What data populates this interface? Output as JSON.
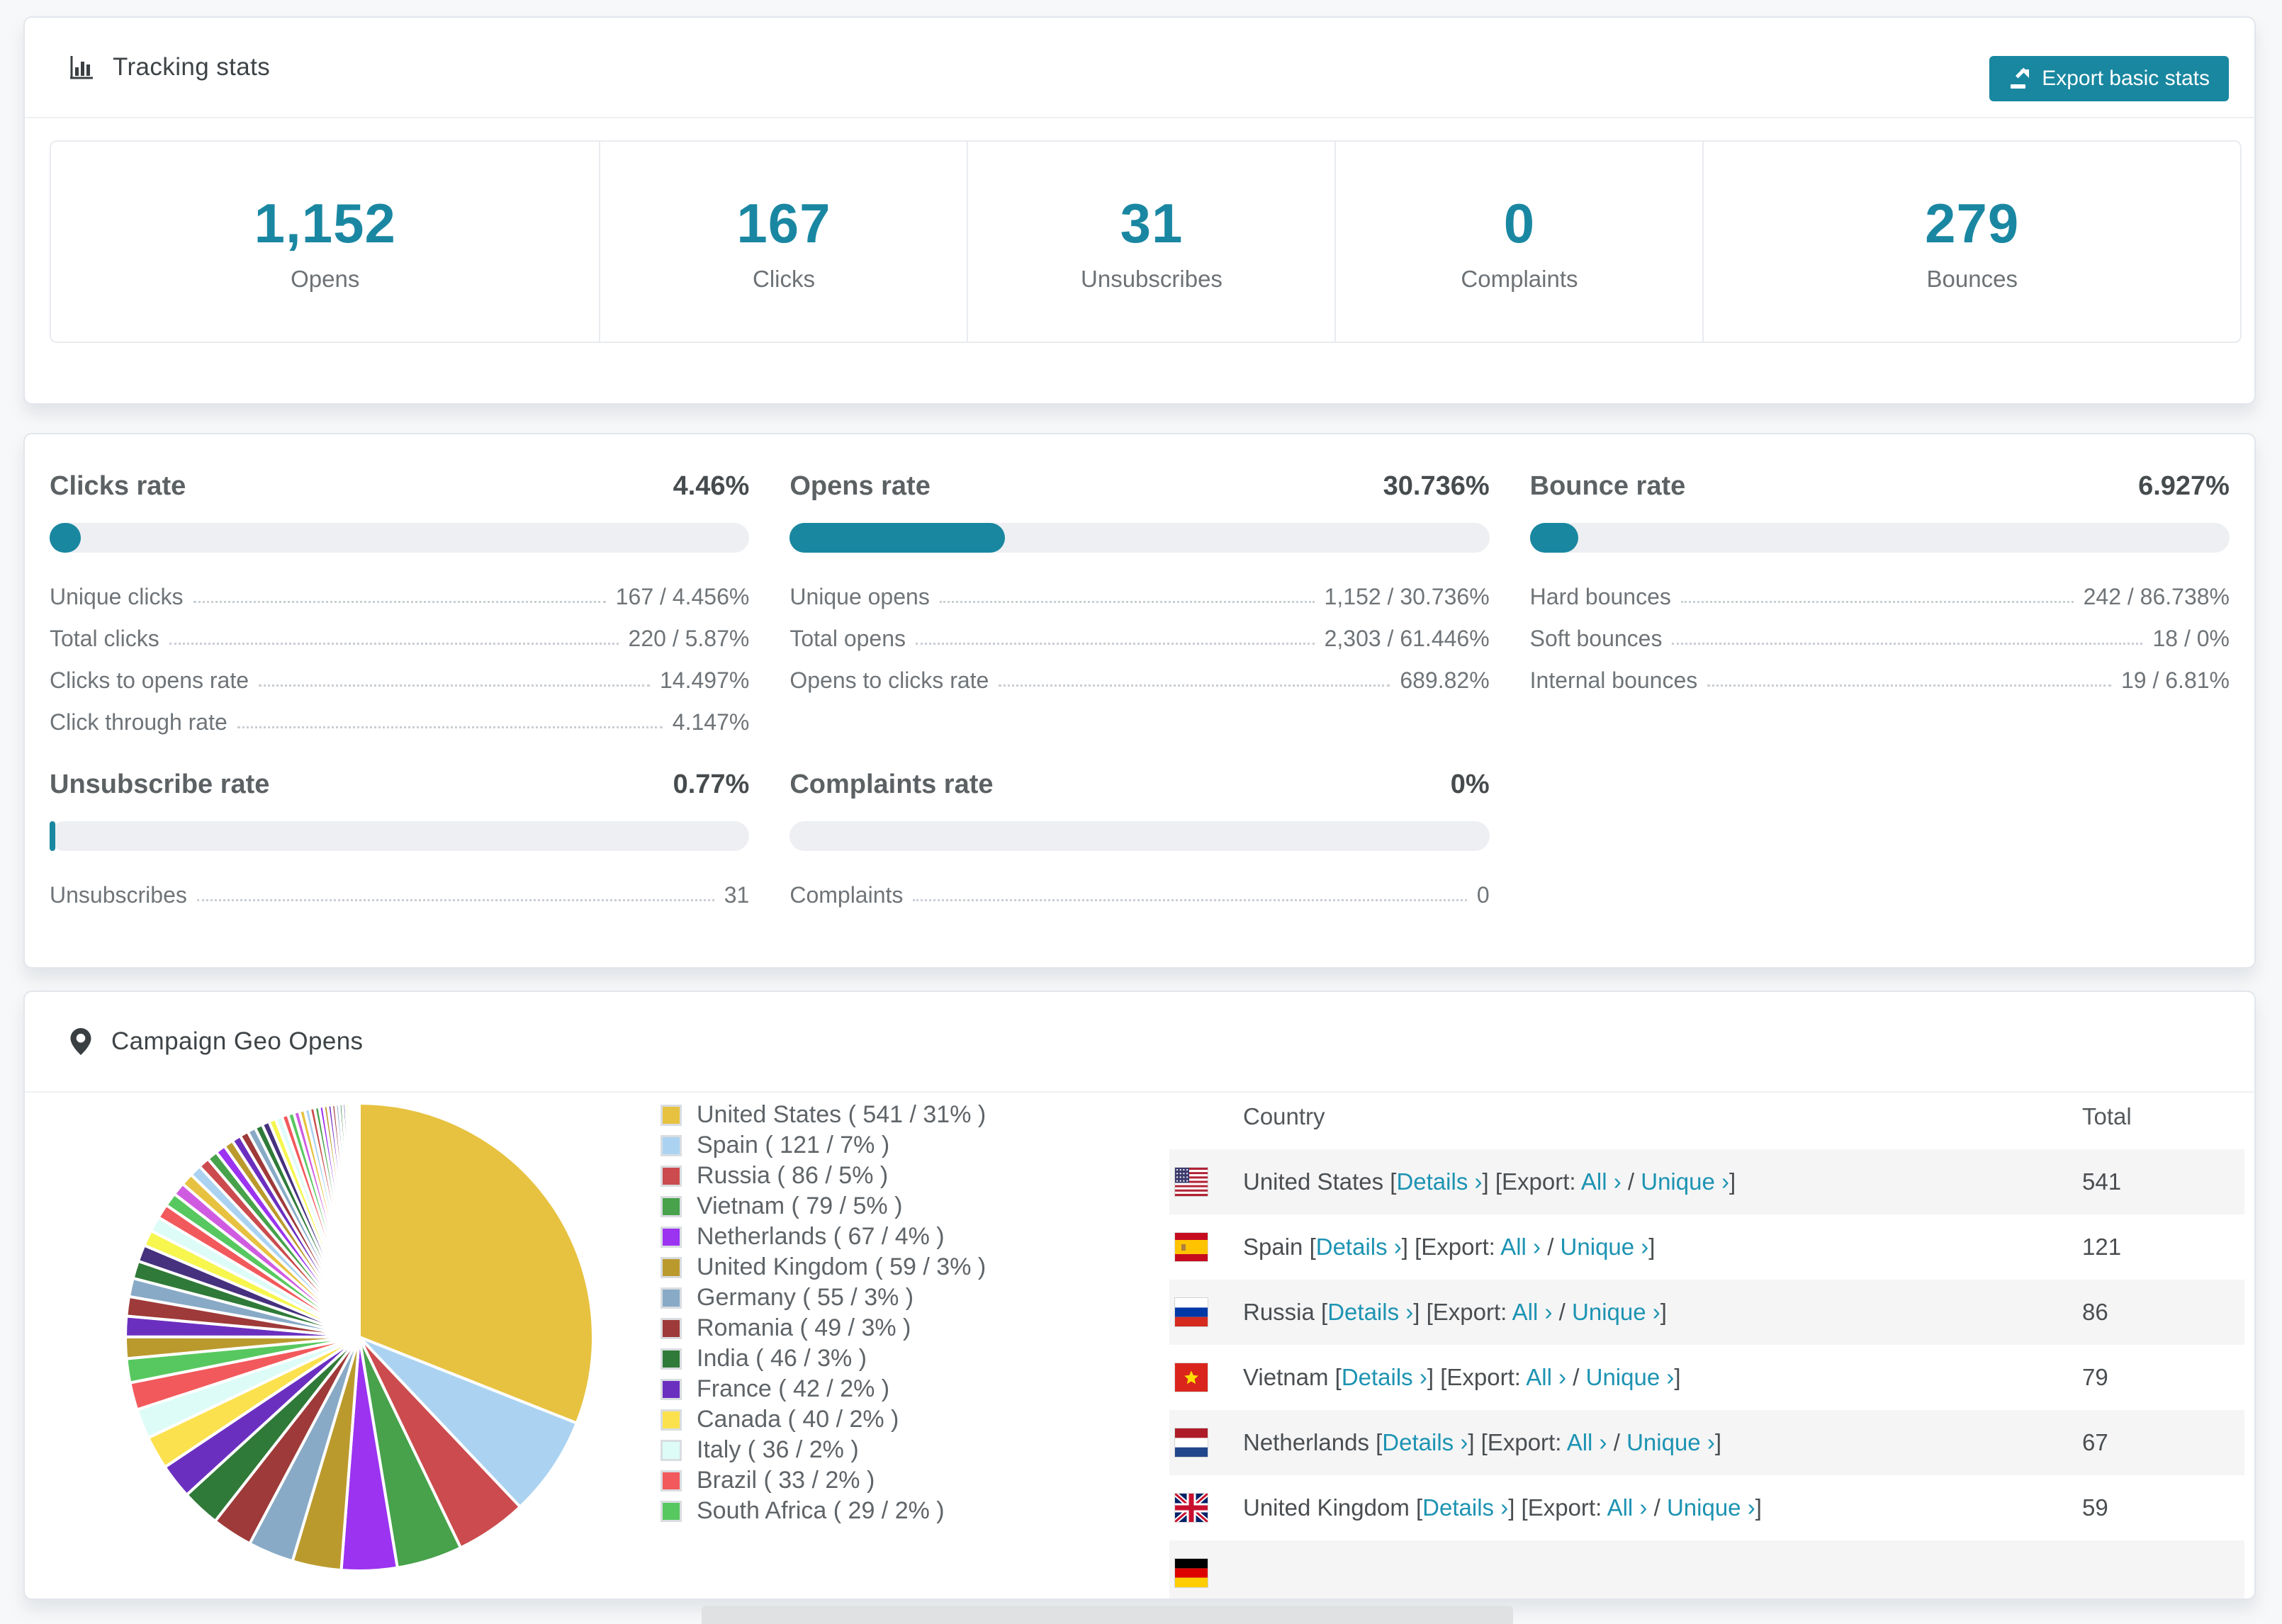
{
  "colors": {
    "accent": "#1987a0",
    "link": "#1d93b2"
  },
  "header": {
    "title": "Tracking stats",
    "export_label": "Export basic stats"
  },
  "summary_stats": [
    {
      "value": "1,152",
      "label": "Opens"
    },
    {
      "value": "167",
      "label": "Clicks"
    },
    {
      "value": "31",
      "label": "Unsubscribes"
    },
    {
      "value": "0",
      "label": "Complaints"
    },
    {
      "value": "279",
      "label": "Bounces"
    }
  ],
  "rate_panels": [
    {
      "title": "Clicks rate",
      "value": "4.46%",
      "percent": 4.46,
      "rows": [
        {
          "label": "Unique clicks",
          "value": "167 / 4.456%"
        },
        {
          "label": "Total clicks",
          "value": "220 / 5.87%"
        },
        {
          "label": "Clicks to opens rate",
          "value": "14.497%"
        },
        {
          "label": "Click through rate",
          "value": "4.147%"
        }
      ]
    },
    {
      "title": "Opens rate",
      "value": "30.736%",
      "percent": 30.736,
      "rows": [
        {
          "label": "Unique opens",
          "value": "1,152 / 30.736%"
        },
        {
          "label": "Total opens",
          "value": "2,303 / 61.446%"
        },
        {
          "label": "Opens to clicks rate",
          "value": "689.82%"
        }
      ]
    },
    {
      "title": "Bounce rate",
      "value": "6.927%",
      "percent": 6.927,
      "rows": [
        {
          "label": "Hard bounces",
          "value": "242 / 86.738%"
        },
        {
          "label": "Soft bounces",
          "value": "18 / 0%"
        },
        {
          "label": "Internal bounces",
          "value": "19 / 6.81%"
        }
      ]
    },
    {
      "title": "Unsubscribe rate",
      "value": "0.77%",
      "percent": 0.77,
      "rows": [
        {
          "label": "Unsubscribes",
          "value": "31"
        }
      ]
    },
    {
      "title": "Complaints rate",
      "value": "0%",
      "percent": 0,
      "rows": [
        {
          "label": "Complaints",
          "value": "0"
        }
      ]
    }
  ],
  "geo": {
    "title": "Campaign Geo Opens",
    "chart_data": {
      "type": "pie",
      "title": "Campaign Geo Opens",
      "legend_position": "right",
      "direction": "clockwise",
      "start_angle_deg": 0,
      "labels": [
        "United States",
        "Spain",
        "Russia",
        "Vietnam",
        "Netherlands",
        "United Kingdom",
        "Germany",
        "Romania",
        "India",
        "France",
        "Canada",
        "Italy",
        "Brazil",
        "South Africa"
      ],
      "values": [
        541,
        121,
        86,
        79,
        67,
        59,
        55,
        49,
        46,
        42,
        40,
        36,
        33,
        29
      ],
      "percent_labels": [
        "31%",
        "7%",
        "5%",
        "5%",
        "4%",
        "3%",
        "3%",
        "3%",
        "3%",
        "2%",
        "2%",
        "2%",
        "2%",
        "2%"
      ],
      "colors": [
        "#e7c240",
        "#abd3f1",
        "#cb4b4e",
        "#47a24b",
        "#9b33f0",
        "#bb9a2d",
        "#88aac7",
        "#9e3a39",
        "#2f7a38",
        "#6b2fc0",
        "#fbe14e",
        "#ddfcf7",
        "#f2595c",
        "#57c85f"
      ],
      "legend_format": "{label} ( {value} / {pct} )",
      "others": {
        "estimated_total": 462,
        "note": "many small unlabeled slices tapering to hairlines"
      }
    },
    "table": {
      "columns": [
        "Country",
        "Total"
      ],
      "syntax": {
        "open": "[",
        "close": "]",
        "details": "Details ›",
        "export": "Export:",
        "all": "All ›",
        "unique": "Unique ›",
        "slash": "/"
      },
      "rows": [
        {
          "flag": "us",
          "country": "United States",
          "total": "541"
        },
        {
          "flag": "es",
          "country": "Spain",
          "total": "121"
        },
        {
          "flag": "ru",
          "country": "Russia",
          "total": "86"
        },
        {
          "flag": "vn",
          "country": "Vietnam",
          "total": "79"
        },
        {
          "flag": "nl",
          "country": "Netherlands",
          "total": "67"
        },
        {
          "flag": "gb",
          "country": "United Kingdom",
          "total": "59"
        },
        {
          "flag": "de",
          "country": "",
          "total": ""
        }
      ]
    }
  }
}
